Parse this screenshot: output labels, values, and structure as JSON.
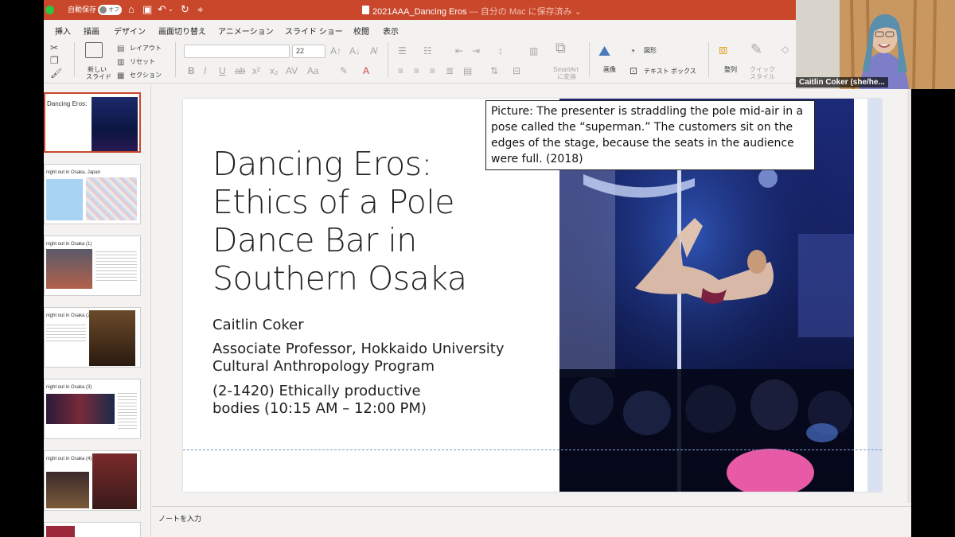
{
  "titlebar": {
    "autosave_label": "自動保存",
    "autosave_state": "オフ",
    "document_title": "2021AAA_Dancing Eros",
    "save_status": "— 自分の Mac に保存済み ⌄"
  },
  "tabs": [
    {
      "label": "挿入"
    },
    {
      "label": "描画"
    },
    {
      "label": "デザイン"
    },
    {
      "label": "画面切り替え"
    },
    {
      "label": "アニメーション"
    },
    {
      "label": "スライド ショー"
    },
    {
      "label": "校閲"
    },
    {
      "label": "表示"
    }
  ],
  "ribbon": {
    "new_slide": "新しい",
    "new_slide_2": "スライド",
    "layout": "レイアウト",
    "reset": "リセット",
    "section": "セクション",
    "font_size": "22",
    "smartart": "SmartArt",
    "smartart_2": "に変換",
    "image": "画像",
    "shapes": "図形",
    "textbox": "テキスト ボックス",
    "arrange": "整列",
    "quick_style": "クイック",
    "quick_style_2": "スタイル"
  },
  "thumbnails": [
    {
      "title": "Dancing Eros:"
    },
    {
      "title": "night out in Osaka, Japan"
    },
    {
      "title": "night out in Osaka (1)"
    },
    {
      "title": "night out in Osaka (2)"
    },
    {
      "title": "night out in Osaka (3)"
    },
    {
      "title": "night out in Osaka (4)"
    }
  ],
  "slide": {
    "title_lines": [
      "Dancing Eros:",
      "Ethics of a Pole",
      "Dance Bar in",
      "Southern Osaka"
    ],
    "author": "Caitlin Coker",
    "affiliation_1": "Associate Professor, Hokkaido University",
    "affiliation_2": "Cultural Anthropology Program",
    "session_1": "(2-1420) Ethically productive",
    "session_2": "bodies (10:15 AM – 12:00 PM)",
    "caption": "Picture: The presenter is straddling the pole mid-air in a pose called the “superman.” The customers sit on the edges of the stage, because the seats in the audience were full. (2018)"
  },
  "notes_placeholder": "ノートを入力",
  "video": {
    "participant_name": "Caitlin Coker (she/he..."
  },
  "colors": {
    "titlebar": "#c9472b",
    "ribbon_bg": "#f3f2f1"
  }
}
